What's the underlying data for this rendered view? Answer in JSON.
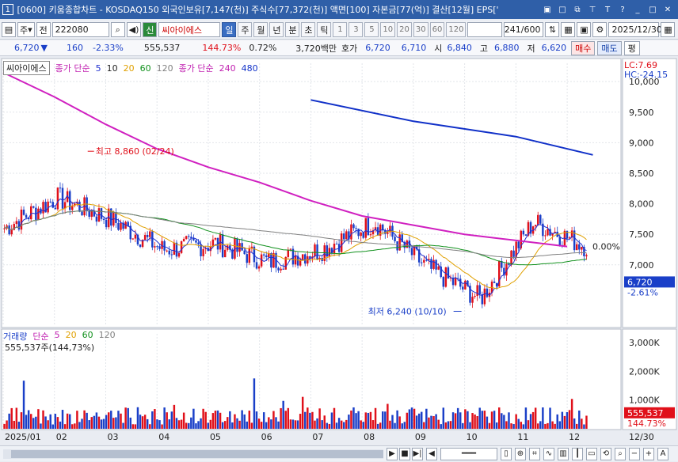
{
  "title": {
    "window_num": "1",
    "text": "[0600] 키움종합차트 - KOSDAQ150 외국인보유[7,147(천)] 주식수[77,372(천)] 액면[100] 자본금[77(억)] 결산[12월] EPS['",
    "icons": [
      "save-icon",
      "window-icon",
      "link-icon",
      "pin-icon",
      "text-icon",
      "help-icon",
      "minimize-icon",
      "maximize-icon",
      "close-icon"
    ]
  },
  "toolbar": {
    "market": "주",
    "prev_label": "전",
    "code": "222080",
    "stock_name": "씨아이에스",
    "stock_badge": "신",
    "periods": [
      "일",
      "주",
      "월",
      "년",
      "분",
      "초",
      "틱"
    ],
    "active_period": "일",
    "minute_steps": [
      "1",
      "3",
      "5",
      "10",
      "20",
      "30",
      "60",
      "120"
    ],
    "count": "241",
    "count_total": "/600",
    "date": "2025/12/30"
  },
  "quote": {
    "price": "6,720",
    "change": "160",
    "change_pct": "-2.33%",
    "volume": "555,537",
    "vol_pct": "144.73%",
    "turnover": "0.72%",
    "amount": "3,720백만",
    "ask_label": "호가",
    "ask1": "6,720",
    "ask2": "6,710",
    "open_label": "시",
    "open": "6,840",
    "high_label": "고",
    "high": "6,880",
    "low_label": "저",
    "low": "6,620",
    "buy_label": "매수",
    "sell_label": "매도",
    "eval_label": "평"
  },
  "legend_price": {
    "name": "씨아이에스",
    "ma_label": "종가 단순",
    "ma5": "5",
    "ma10": "10",
    "ma20": "20",
    "ma60": "60",
    "ma120": "120",
    "ma_long_label": "종가 단순",
    "ma240": "240",
    "ma480": "480"
  },
  "legend_vol": {
    "name": "거래량",
    "ma_label": "단순",
    "ma5": "5",
    "ma20": "20",
    "ma60": "60",
    "ma120": "120",
    "info": "555,537주(144,73%)"
  },
  "price_axis": {
    "ticks": [
      "10,000",
      "9,500",
      "9,000",
      "8,500",
      "8,000",
      "7,500",
      "7,000"
    ],
    "lc": "LC:7.69",
    "hc": "HC:-24.15",
    "current": "6,720",
    "current_pct": "-2.61%",
    "pct_marker": "0.00%"
  },
  "vol_axis": {
    "ticks": [
      "3,000K",
      "2,000K",
      "1,000K"
    ],
    "current": "555,537",
    "current_pct": "144.73%"
  },
  "annotations": {
    "high": "최고 8,860 (02/24)",
    "low": "최저 6,240 (10/10)"
  },
  "x_axis": {
    "labels": [
      "2025/01",
      "02",
      "03",
      "04",
      "05",
      "06",
      "07",
      "08",
      "09",
      "10",
      "11",
      "12"
    ],
    "end_label": "12/30"
  },
  "colors": {
    "up": "#e0101a",
    "down": "#1a3fc8",
    "ma5": "#2030d0",
    "ma20": "#e0a000",
    "ma60": "#10901c",
    "ma120": "#808080",
    "ma240": "#d020c0",
    "ma480": "#1030c8",
    "accent": "#2f5fa8"
  },
  "chart_data": {
    "type": "candlestick",
    "ylim": [
      6000,
      10300
    ],
    "volume_ylim": [
      0,
      3300
    ],
    "x_months": [
      "2025/01",
      "02",
      "03",
      "04",
      "05",
      "06",
      "07",
      "08",
      "09",
      "10",
      "11",
      "12"
    ],
    "monthly_close": [
      7600,
      8100,
      7750,
      7250,
      7350,
      7050,
      7250,
      7700,
      6950,
      6450,
      7700,
      7300
    ],
    "ma240_points": [
      [
        1,
        10150
      ],
      [
        2,
        9750
      ],
      [
        3,
        9300
      ],
      [
        4,
        8900
      ],
      [
        5,
        8600
      ],
      [
        6,
        8350
      ],
      [
        7,
        8050
      ],
      [
        8,
        7800
      ],
      [
        9,
        7650
      ],
      [
        10,
        7500
      ],
      [
        11,
        7400
      ],
      [
        12,
        7300
      ]
    ],
    "ma480_points": [
      [
        7,
        9700
      ],
      [
        9,
        9350
      ],
      [
        11,
        9100
      ],
      [
        12.5,
        8800
      ]
    ],
    "volume_ma5_peak": 2000,
    "notes": []
  }
}
